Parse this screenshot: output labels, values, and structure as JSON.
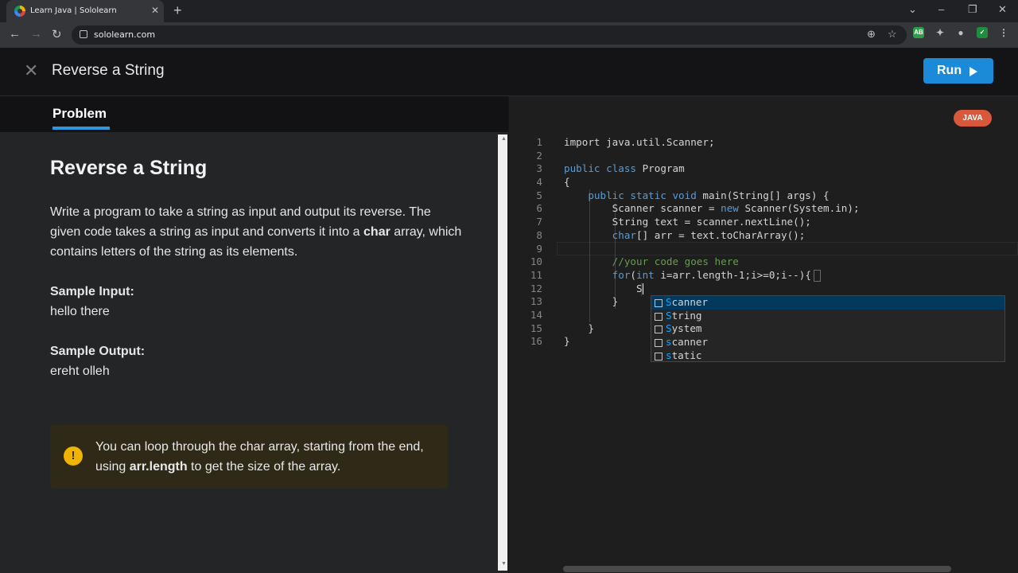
{
  "browser": {
    "tab_title": "Learn Java | Sololearn",
    "url": "sololearn.com"
  },
  "app": {
    "lesson_title": "Reverse a String",
    "run_label": "Run"
  },
  "problem": {
    "tab_label": "Problem",
    "heading": "Reverse a String",
    "description_pre": "Write a program to take a string as input and output its reverse. The given code takes a string as input and converts it into a ",
    "description_bold": "char",
    "description_post": " array, which contains letters of the string as its elements.",
    "sample_input_label": "Sample Input:",
    "sample_input": "hello there",
    "sample_output_label": "Sample Output:",
    "sample_output": "ereht olleh",
    "hint_pre": "You can loop through the char array, starting from the end, using ",
    "hint_bold": "arr.length",
    "hint_post": " to get the size of the array."
  },
  "editor": {
    "language_badge": "JAVA",
    "line_numbers": [
      "1",
      "2",
      "3",
      "4",
      "5",
      "6",
      "7",
      "8",
      "9",
      "10",
      "11",
      "12",
      "13",
      "14",
      "15",
      "16"
    ],
    "lines": {
      "l1": "import java.util.Scanner;",
      "l3a": "public class",
      "l3b": " Program",
      "l4": "{",
      "l5a": "    public static void",
      "l5b": " main(String[] args) {",
      "l6a": "        Scanner scanner = ",
      "l6b": "new",
      "l6c": " Scanner(System.in);",
      "l7": "        String text = scanner.nextLine();",
      "l8a": "        ",
      "l8b": "char",
      "l8c": "[] arr = text.toCharArray();",
      "l10": "        //your code goes here",
      "l11a": "        ",
      "l11b": "for",
      "l11c": "(",
      "l11d": "int",
      "l11e": " i=arr.length-1;i>=0;i--){",
      "l12": "            S",
      "l13": "        }",
      "l15": "    }",
      "l16": "}"
    },
    "suggestions": [
      {
        "match": "S",
        "rest": "canner"
      },
      {
        "match": "S",
        "rest": "tring"
      },
      {
        "match": "S",
        "rest": "ystem"
      },
      {
        "match": "s",
        "rest": "canner"
      },
      {
        "match": "s",
        "rest": "tatic"
      }
    ]
  }
}
